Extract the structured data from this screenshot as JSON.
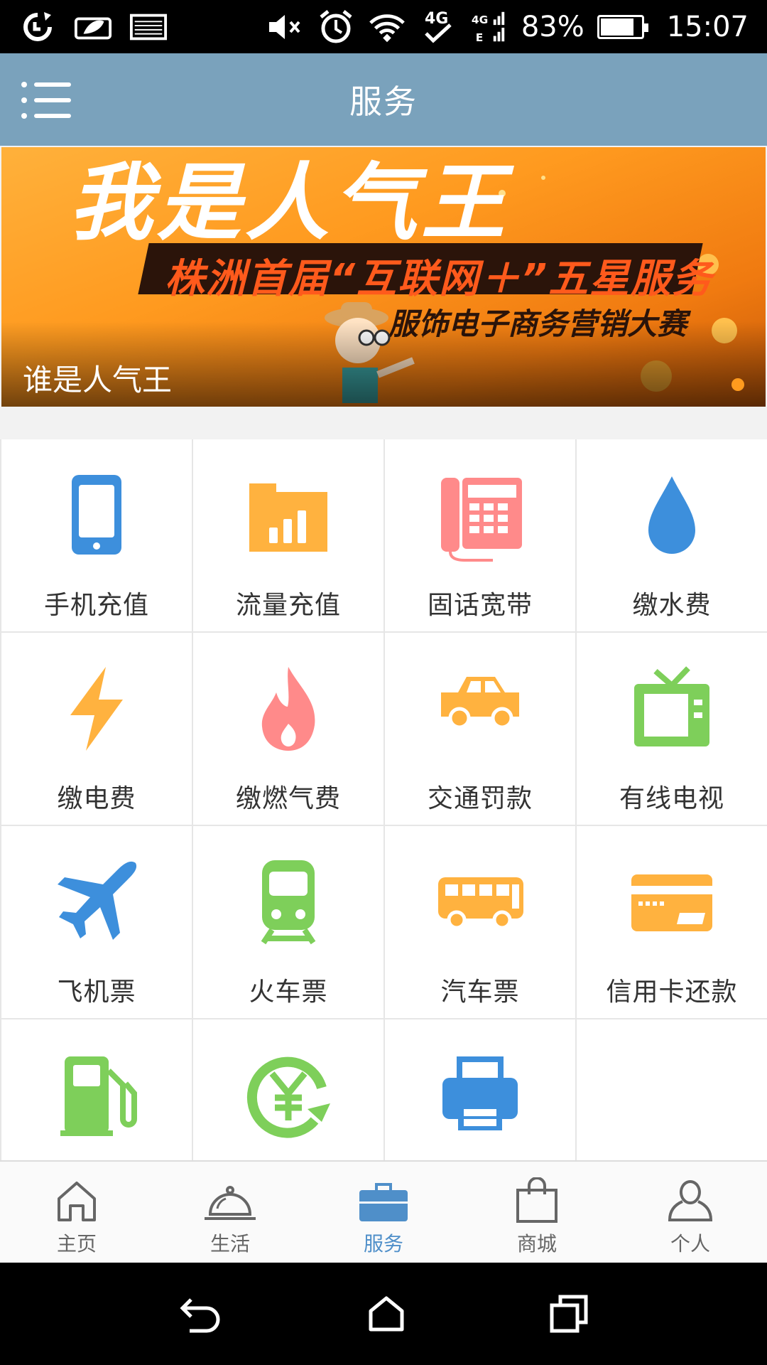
{
  "status_bar": {
    "battery_percent": "83%",
    "battery_level": 0.83,
    "time": "15:07",
    "network": "4G",
    "icons": [
      "sync-icon",
      "leaf-icon",
      "image-icon",
      "mute-icon",
      "alarm-icon",
      "wifi-icon",
      "4g-check-icon",
      "signal-icon",
      "battery-icon"
    ]
  },
  "header": {
    "title": "服务",
    "menu_icon": "menu-icon"
  },
  "banner": {
    "headline": "我是人气王",
    "subline": "株洲首届“互联网＋”五星服务",
    "subline2": "服饰电子商务营销大赛",
    "caption": "谁是人气王"
  },
  "services": [
    {
      "label": "手机充值",
      "icon": "mobile-phone-icon",
      "color": "#3d8fdc"
    },
    {
      "label": "流量充值",
      "icon": "data-folder-icon",
      "color": "#ffb23f"
    },
    {
      "label": "固话宽带",
      "icon": "landline-phone-icon",
      "color": "#ff8a8a"
    },
    {
      "label": "缴水费",
      "icon": "water-drop-icon",
      "color": "#3d8fdc"
    },
    {
      "label": "缴电费",
      "icon": "lightning-icon",
      "color": "#ffb23f"
    },
    {
      "label": "缴燃气费",
      "icon": "flame-icon",
      "color": "#ff8a8a"
    },
    {
      "label": "交通罚款",
      "icon": "car-icon",
      "color": "#ffb23f"
    },
    {
      "label": "有线电视",
      "icon": "tv-icon",
      "color": "#7ecf5a"
    },
    {
      "label": "飞机票",
      "icon": "airplane-icon",
      "color": "#3d8fdc"
    },
    {
      "label": "火车票",
      "icon": "train-icon",
      "color": "#7ecf5a"
    },
    {
      "label": "汽车票",
      "icon": "bus-icon",
      "color": "#ffb23f"
    },
    {
      "label": "信用卡还款",
      "icon": "credit-card-icon",
      "color": "#ffb23f"
    },
    {
      "label": "",
      "icon": "gas-pump-icon",
      "color": "#7ecf5a"
    },
    {
      "label": "",
      "icon": "yuan-refresh-icon",
      "color": "#7ecf5a"
    },
    {
      "label": "",
      "icon": "printer-icon",
      "color": "#3d8fdc"
    },
    {
      "label": "",
      "icon": "",
      "color": ""
    }
  ],
  "tabs": [
    {
      "label": "主页",
      "icon": "home-icon"
    },
    {
      "label": "生活",
      "icon": "service-bell-icon"
    },
    {
      "label": "服务",
      "icon": "briefcase-icon",
      "active": true
    },
    {
      "label": "商城",
      "icon": "shopping-bag-icon"
    },
    {
      "label": "个人",
      "icon": "person-icon"
    }
  ],
  "colors": {
    "header": "#7aa2bc",
    "active_tab": "#4f8fc9",
    "blue": "#3d8fdc",
    "orange": "#ffb23f",
    "pink": "#ff8a8a",
    "green": "#7ecf5a"
  },
  "nav_buttons": [
    "back-icon",
    "home-nav-icon",
    "recent-apps-icon"
  ]
}
